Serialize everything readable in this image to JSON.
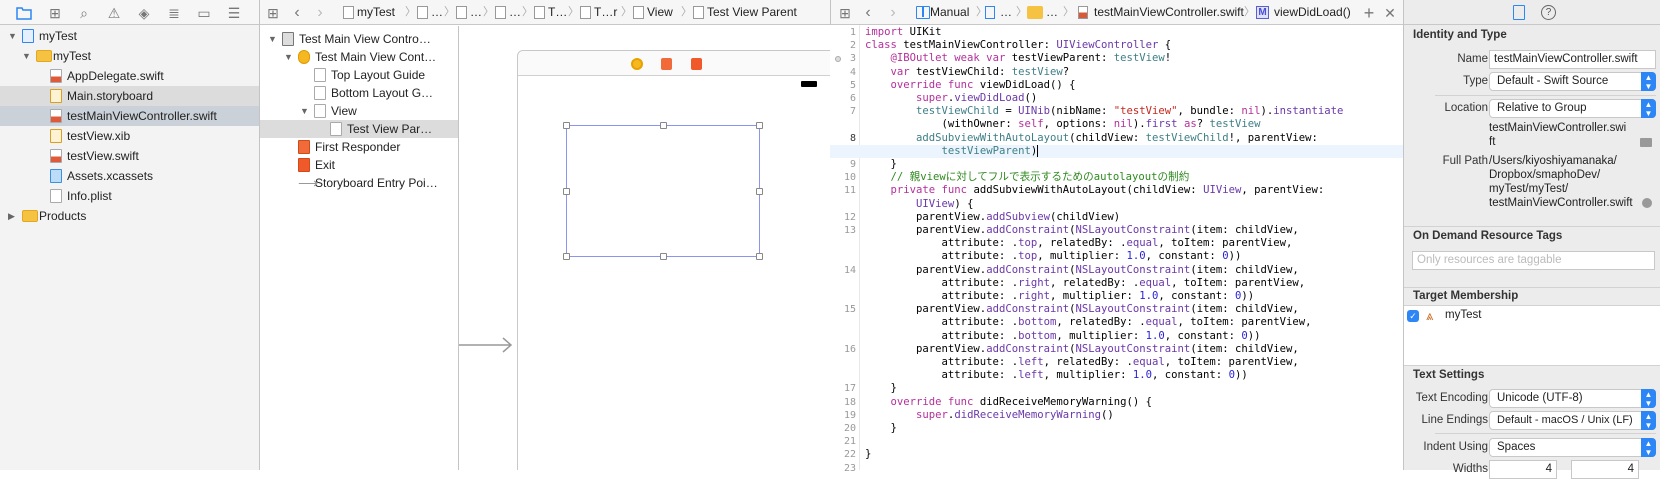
{
  "navigator": {
    "toolbar_icons": [
      "folder-icon",
      "hierarchy-icon",
      "search-icon",
      "warning-icon",
      "test-diamond-icon",
      "list-icon",
      "breakpoint-icon",
      "report-icon"
    ],
    "items": [
      {
        "label": "myTest",
        "level": 0,
        "icon": "project",
        "disclosure": "open"
      },
      {
        "label": "myTest",
        "level": 1,
        "icon": "folder",
        "disclosure": "open"
      },
      {
        "label": "AppDelegate.swift",
        "level": 2,
        "icon": "swift"
      },
      {
        "label": "Main.storyboard",
        "level": 2,
        "icon": "storyboard",
        "state": "hover"
      },
      {
        "label": "testMainViewController.swift",
        "level": 2,
        "icon": "swift",
        "state": "selected"
      },
      {
        "label": "testView.xib",
        "level": 2,
        "icon": "xib"
      },
      {
        "label": "testView.swift",
        "level": 2,
        "icon": "swift"
      },
      {
        "label": "Assets.xcassets",
        "level": 2,
        "icon": "assets"
      },
      {
        "label": "Info.plist",
        "level": 2,
        "icon": "plist"
      },
      {
        "label": "Products",
        "level": 0,
        "icon": "folder",
        "disclosure": "closed"
      }
    ]
  },
  "storyboard": {
    "jumpbar": [
      "myTest",
      "…",
      "…",
      "…",
      "T…",
      "T…r",
      "View",
      "Test View Parent"
    ],
    "outline": [
      {
        "label": "Test Main View Contro…",
        "level": 0,
        "icon": "scene",
        "disclosure": "open"
      },
      {
        "label": "Test Main View Cont…",
        "level": 1,
        "icon": "vc",
        "disclosure": "open"
      },
      {
        "label": "Top Layout Guide",
        "level": 2,
        "icon": "guide"
      },
      {
        "label": "Bottom Layout G…",
        "level": 2,
        "icon": "guide"
      },
      {
        "label": "View",
        "level": 2,
        "icon": "view",
        "disclosure": "open"
      },
      {
        "label": "Test View Par…",
        "level": 3,
        "icon": "view",
        "state": "selected"
      },
      {
        "label": "First Responder",
        "level": 1,
        "icon": "responder"
      },
      {
        "label": "Exit",
        "level": 1,
        "icon": "exit"
      },
      {
        "label": "Storyboard Entry Poi…",
        "level": 1,
        "icon": "arrow"
      }
    ]
  },
  "editor": {
    "jumpbar": {
      "mode": "Manual",
      "group1": "…",
      "group2": "…",
      "file": "testMainViewController.swift",
      "method": "viewDidLoad()"
    },
    "lines": [
      {
        "n": "1",
        "t": [
          [
            "import",
            "k"
          ],
          [
            " UIKit",
            ""
          ]
        ]
      },
      {
        "n": "2",
        "t": [
          [
            "class",
            "k"
          ],
          [
            " testMainViewController: ",
            ""
          ],
          [
            "UIViewController",
            "p"
          ],
          [
            " {",
            ""
          ]
        ]
      },
      {
        "n": "3",
        "t": [
          [
            "    ",
            ""
          ],
          [
            "@IBOutlet weak var",
            "k"
          ],
          [
            " testViewParent: ",
            ""
          ],
          [
            "testView",
            "t"
          ],
          [
            "!",
            ""
          ]
        ]
      },
      {
        "n": "4",
        "t": [
          [
            "    ",
            ""
          ],
          [
            "var",
            "k"
          ],
          [
            " testViewChild: ",
            ""
          ],
          [
            "testView",
            "t"
          ],
          [
            "?",
            ""
          ]
        ]
      },
      {
        "n": "5",
        "t": [
          [
            "    ",
            ""
          ],
          [
            "override func",
            "k"
          ],
          [
            " viewDidLoad() {",
            ""
          ]
        ]
      },
      {
        "n": "6",
        "t": [
          [
            "        ",
            ""
          ],
          [
            "super",
            "k"
          ],
          [
            ".",
            ""
          ],
          [
            "viewDidLoad",
            "p"
          ],
          [
            "()",
            ""
          ]
        ]
      },
      {
        "n": "7",
        "t": [
          [
            "        ",
            ""
          ],
          [
            "testViewChild",
            "t"
          ],
          [
            " = ",
            ""
          ],
          [
            "UINib",
            "p"
          ],
          [
            "(nibName: ",
            ""
          ],
          [
            "\"testView\"",
            "s"
          ],
          [
            ", bundle: ",
            ""
          ],
          [
            "nil",
            "k"
          ],
          [
            ").",
            ""
          ],
          [
            "instantiate",
            "p"
          ]
        ]
      },
      {
        "n": "",
        "t": [
          [
            "            (withOwner: ",
            ""
          ],
          [
            "self",
            "k"
          ],
          [
            ", options: ",
            ""
          ],
          [
            "nil",
            "k"
          ],
          [
            ").",
            ""
          ],
          [
            "first",
            "p"
          ],
          [
            " ",
            ""
          ],
          [
            "as",
            "k"
          ],
          [
            "? ",
            ""
          ],
          [
            "testView",
            "t"
          ]
        ]
      },
      {
        "n": "8",
        "t": [
          [
            "        ",
            ""
          ],
          [
            "addSubviewWithAutoLayout",
            "t"
          ],
          [
            "(childView: ",
            ""
          ],
          [
            "testViewChild",
            "t"
          ],
          [
            "!, parentView:",
            ""
          ]
        ]
      },
      {
        "n": "",
        "hl": true,
        "cursor": true,
        "t": [
          [
            "            ",
            ""
          ],
          [
            "testViewParent",
            "t"
          ],
          [
            ")",
            ""
          ]
        ]
      },
      {
        "n": "9",
        "t": [
          [
            "    }",
            ""
          ]
        ]
      },
      {
        "n": "10",
        "t": [
          [
            "    ",
            ""
          ],
          [
            "// 親viewに対してフルで表示するためのautolayoutの制約",
            "c"
          ]
        ]
      },
      {
        "n": "11",
        "t": [
          [
            "    ",
            ""
          ],
          [
            "private func",
            "k"
          ],
          [
            " addSubviewWithAutoLayout(childView: ",
            ""
          ],
          [
            "UIView",
            "p"
          ],
          [
            ", parentView:",
            ""
          ]
        ]
      },
      {
        "n": "",
        "t": [
          [
            "        ",
            ""
          ],
          [
            "UIView",
            "p"
          ],
          [
            ") {",
            ""
          ]
        ]
      },
      {
        "n": "12",
        "t": [
          [
            "        parentView.",
            ""
          ],
          [
            "addSubview",
            "p"
          ],
          [
            "(childView)",
            ""
          ]
        ]
      },
      {
        "n": "13",
        "t": [
          [
            "        parentView.",
            ""
          ],
          [
            "addConstraint",
            "p"
          ],
          [
            "(",
            ""
          ],
          [
            "NSLayoutConstraint",
            "p"
          ],
          [
            "(item: childView,",
            ""
          ]
        ]
      },
      {
        "n": "",
        "t": [
          [
            "            attribute: .",
            ""
          ],
          [
            "top",
            "p"
          ],
          [
            ", relatedBy: .",
            ""
          ],
          [
            "equal",
            "p"
          ],
          [
            ", toItem: parentView,",
            ""
          ]
        ]
      },
      {
        "n": "",
        "t": [
          [
            "            attribute: .",
            ""
          ],
          [
            "top",
            "p"
          ],
          [
            ", multiplier: ",
            ""
          ],
          [
            "1.0",
            "n"
          ],
          [
            ", constant: ",
            ""
          ],
          [
            "0",
            "n"
          ],
          [
            "))",
            ""
          ]
        ]
      },
      {
        "n": "14",
        "t": [
          [
            "        parentView.",
            ""
          ],
          [
            "addConstraint",
            "p"
          ],
          [
            "(",
            ""
          ],
          [
            "NSLayoutConstraint",
            "p"
          ],
          [
            "(item: childView,",
            ""
          ]
        ]
      },
      {
        "n": "",
        "t": [
          [
            "            attribute: .",
            ""
          ],
          [
            "right",
            "p"
          ],
          [
            ", relatedBy: .",
            ""
          ],
          [
            "equal",
            "p"
          ],
          [
            ", toItem: parentView,",
            ""
          ]
        ]
      },
      {
        "n": "",
        "t": [
          [
            "            attribute: .",
            ""
          ],
          [
            "right",
            "p"
          ],
          [
            ", multiplier: ",
            ""
          ],
          [
            "1.0",
            "n"
          ],
          [
            ", constant: ",
            ""
          ],
          [
            "0",
            "n"
          ],
          [
            "))",
            ""
          ]
        ]
      },
      {
        "n": "15",
        "t": [
          [
            "        parentView.",
            ""
          ],
          [
            "addConstraint",
            "p"
          ],
          [
            "(",
            ""
          ],
          [
            "NSLayoutConstraint",
            "p"
          ],
          [
            "(item: childView,",
            ""
          ]
        ]
      },
      {
        "n": "",
        "t": [
          [
            "            attribute: .",
            ""
          ],
          [
            "bottom",
            "p"
          ],
          [
            ", relatedBy: .",
            ""
          ],
          [
            "equal",
            "p"
          ],
          [
            ", toItem: parentView,",
            ""
          ]
        ]
      },
      {
        "n": "",
        "t": [
          [
            "            attribute: .",
            ""
          ],
          [
            "bottom",
            "p"
          ],
          [
            ", multiplier: ",
            ""
          ],
          [
            "1.0",
            "n"
          ],
          [
            ", constant: ",
            ""
          ],
          [
            "0",
            "n"
          ],
          [
            "))",
            ""
          ]
        ]
      },
      {
        "n": "16",
        "t": [
          [
            "        parentView.",
            ""
          ],
          [
            "addConstraint",
            "p"
          ],
          [
            "(",
            ""
          ],
          [
            "NSLayoutConstraint",
            "p"
          ],
          [
            "(item: childView,",
            ""
          ]
        ]
      },
      {
        "n": "",
        "t": [
          [
            "            attribute: .",
            ""
          ],
          [
            "left",
            "p"
          ],
          [
            ", relatedBy: .",
            ""
          ],
          [
            "equal",
            "p"
          ],
          [
            ", toItem: parentView,",
            ""
          ]
        ]
      },
      {
        "n": "",
        "t": [
          [
            "            attribute: .",
            ""
          ],
          [
            "left",
            "p"
          ],
          [
            ", multiplier: ",
            ""
          ],
          [
            "1.0",
            "n"
          ],
          [
            ", constant: ",
            ""
          ],
          [
            "0",
            "n"
          ],
          [
            "))",
            ""
          ]
        ]
      },
      {
        "n": "17",
        "t": [
          [
            "    }",
            ""
          ]
        ]
      },
      {
        "n": "18",
        "t": [
          [
            "    ",
            ""
          ],
          [
            "override func",
            "k"
          ],
          [
            " didReceiveMemoryWarning() {",
            ""
          ]
        ]
      },
      {
        "n": "19",
        "t": [
          [
            "        ",
            ""
          ],
          [
            "super",
            "k"
          ],
          [
            ".",
            ""
          ],
          [
            "didReceiveMemoryWarning",
            "p"
          ],
          [
            "()",
            ""
          ]
        ]
      },
      {
        "n": "20",
        "t": [
          [
            "    }",
            ""
          ]
        ]
      },
      {
        "n": "21",
        "t": []
      },
      {
        "n": "22",
        "t": [
          [
            "}",
            ""
          ]
        ]
      },
      {
        "n": "23",
        "t": []
      }
    ]
  },
  "inspector": {
    "identity": {
      "title": "Identity and Type",
      "name_label": "Name",
      "name_value": "testMainViewController.swift",
      "type_label": "Type",
      "type_value": "Default - Swift Source",
      "location_label": "Location",
      "location_value": "Relative to Group",
      "location_path_1": "testMainViewController.swi",
      "location_path_2": "ft",
      "fullpath_label": "Full Path",
      "fullpath": [
        "/Users/kiyoshiyamanaka/",
        "Dropbox/smaphoDev/",
        "myTest/myTest/",
        "testMainViewController.swift"
      ]
    },
    "odr": {
      "title": "On Demand Resource Tags",
      "placeholder": "Only resources are taggable"
    },
    "target": {
      "title": "Target Membership",
      "name": "myTest",
      "checked": true
    },
    "text": {
      "title": "Text Settings",
      "encoding_label": "Text Encoding",
      "encoding_value": "Unicode (UTF-8)",
      "endings_label": "Line Endings",
      "endings_value": "Default - macOS / Unix (LF)",
      "indent_label": "Indent Using",
      "indent_value": "Spaces",
      "widths_label": "Widths",
      "tab_width": "4",
      "indent_width": "4"
    }
  },
  "colors": {
    "accent": "#2c86f5",
    "selection": "#ecf5fe"
  }
}
